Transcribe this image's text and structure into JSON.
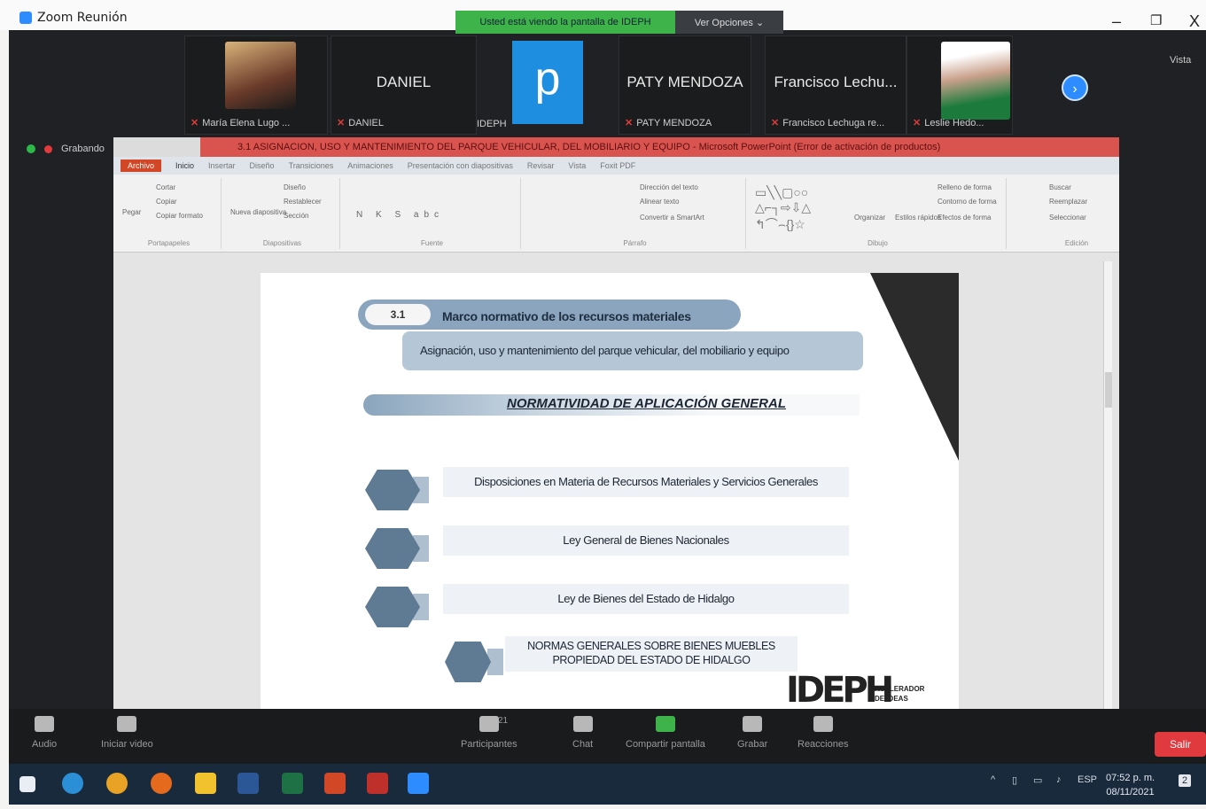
{
  "window": {
    "title": "Zoom Reunión",
    "minimize": "–",
    "maximize": "❐",
    "close": "X"
  },
  "share_banner": {
    "status": "Usted está viendo la pantalla de IDEPH",
    "options": "Ver Opciones ⌄"
  },
  "participants": [
    {
      "tile_name": "",
      "label": "María Elena Lugo ..."
    },
    {
      "tile_name": "DANIEL",
      "label": "DANIEL"
    },
    {
      "tile_name": "p",
      "label": "IDEPH"
    },
    {
      "tile_name": "PATY MENDOZA",
      "label": "PATY MENDOZA"
    },
    {
      "tile_name": "Francisco  Lechu...",
      "label": "Francisco Lechuga re..."
    },
    {
      "tile_name": "",
      "label": "Leslie Hedo..."
    }
  ],
  "view_label": "Vista",
  "recording_label": "Grabando",
  "powerpoint": {
    "title": "3.1 ASIGNACION, USO Y MANTENIMIENTO DEL PARQUE VEHICULAR, DEL MOBILIARIO Y EQUIPO - Microsoft PowerPoint (Error de activación de productos)",
    "tabs": [
      "Archivo",
      "Inicio",
      "Insertar",
      "Diseño",
      "Transiciones",
      "Animaciones",
      "Presentación con diapositivas",
      "Revisar",
      "Vista",
      "Foxit PDF"
    ],
    "groups": {
      "clipboard": "Portapapeles",
      "slides": "Diapositivas",
      "font": "Fuente",
      "paragraph": "Párrafo",
      "drawing": "Dibujo",
      "editing": "Edición"
    },
    "ribbon_items": {
      "paste": "Pegar",
      "cut": "Cortar",
      "copy": "Copiar",
      "format_painter": "Copiar formato",
      "new_slide": "Nueva diapositiva",
      "layout": "Diseño",
      "reset": "Restablecer",
      "section": "Sección",
      "text_direction": "Dirección del texto",
      "align_text": "Alinear texto",
      "smartart": "Convertir a SmartArt",
      "arrange": "Organizar",
      "quick_styles": "Estilos rápidos",
      "shape_fill": "Relleno de forma",
      "shape_outline": "Contorno de forma",
      "shape_effects": "Efectos de forma",
      "find": "Buscar",
      "replace": "Reemplazar",
      "select": "Seleccionar"
    }
  },
  "slide": {
    "section_number": "3.1",
    "section_title": "Marco normativo de los recursos materiales",
    "subtitle": "Asignación, uso y mantenimiento del parque vehicular, del mobiliario y equipo",
    "heading": "NORMATIVIDAD DE  APLICACIÓN GENERAL",
    "items": [
      "Disposiciones en Materia de Recursos Materiales y Servicios Generales",
      "Ley General de Bienes Nacionales",
      "Ley de Bienes del Estado de Hidalgo",
      "NORMAS GENERALES SOBRE BIENES MUEBLES PROPIEDAD DEL ESTADO DE HIDALGO"
    ],
    "logo_text": "IDEPH",
    "logo_tagline": "ACELERADOR DE IDEAS"
  },
  "toolbar": {
    "audio": "Audio",
    "video": "Iniciar video",
    "participants": "Participantes",
    "participants_count": "21",
    "chat": "Chat",
    "share": "Compartir pantalla",
    "record": "Grabar",
    "reactions": "Reacciones",
    "leave": "Salir"
  },
  "taskbar": {
    "language": "ESP",
    "time": "07:52 p. m.",
    "date": "08/11/2021",
    "notifications": "2"
  },
  "colors": {
    "zoom_blue": "#2d8cff",
    "share_green": "#3db34a",
    "leave_red": "#e0393e",
    "ppt_title_red": "#d9534f",
    "slide_accent": "#5f7b94"
  }
}
